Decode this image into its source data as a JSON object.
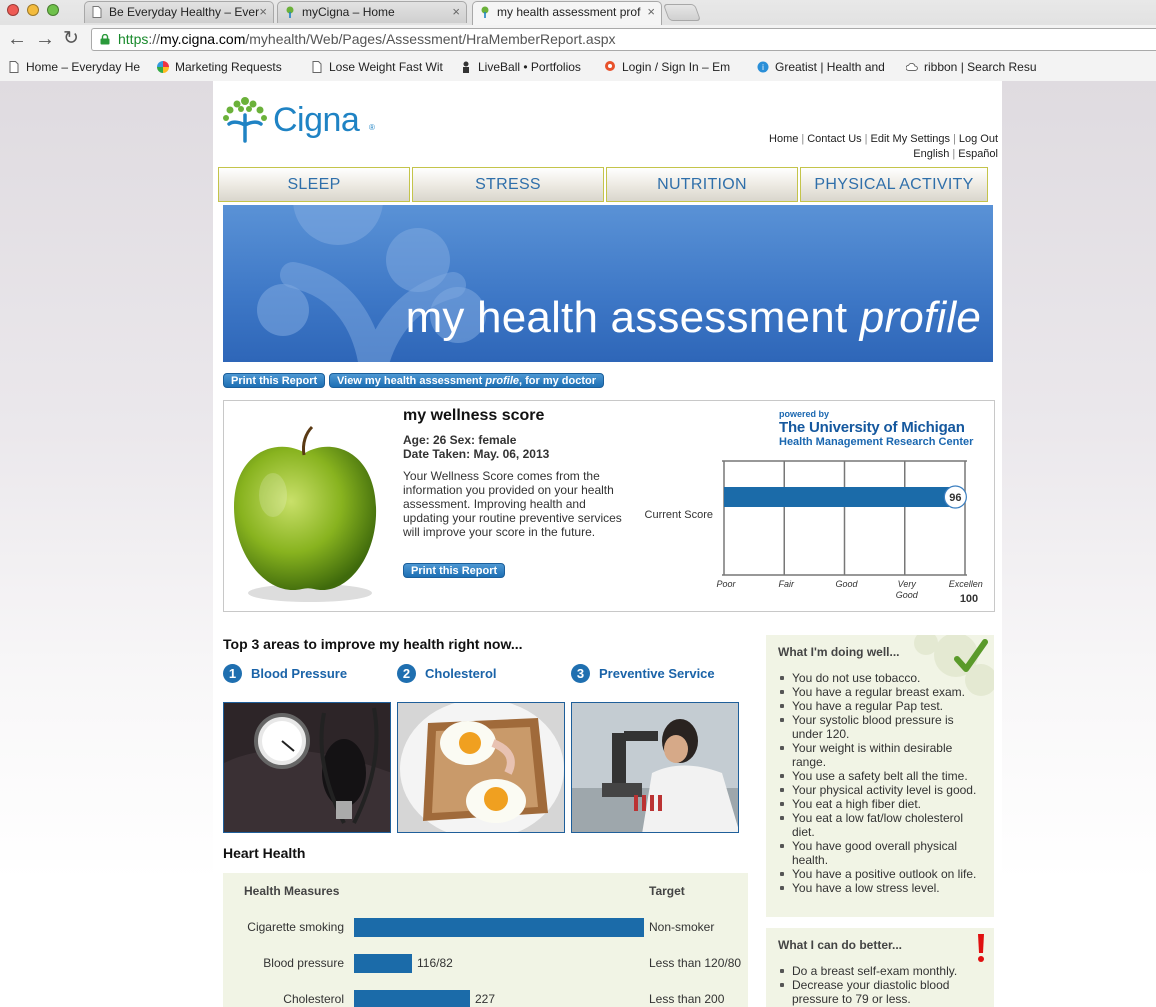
{
  "browser": {
    "tabs": [
      {
        "title": "Be Everyday Healthy – Ever"
      },
      {
        "title": "myCigna – Home"
      },
      {
        "title": "my health assessment prof"
      }
    ],
    "url": {
      "scheme": "https",
      "sep": "://",
      "host": "my.cigna.com",
      "path": "/myhealth/Web/Pages/Assessment/HraMemberReport.aspx"
    },
    "bookmarks": [
      {
        "label": "Home – Everyday He",
        "icon": "page-icon"
      },
      {
        "label": "Marketing Requests",
        "icon": "pinwheel-icon"
      },
      {
        "label": "Lose Weight Fast Wit",
        "icon": "page-icon"
      },
      {
        "label": "LiveBall • Portfolios",
        "icon": "person-icon"
      },
      {
        "label": "Login / Sign In – Em",
        "icon": "pin-icon"
      },
      {
        "label": "Greatist | Health and",
        "icon": "greatist-icon"
      },
      {
        "label": "ribbon | Search Resu",
        "icon": "cloud-icon"
      }
    ],
    "close_glyph": "×"
  },
  "header": {
    "brand": "Cigna",
    "brand_mark": "®",
    "links": [
      "Home",
      "Contact Us",
      "Edit My Settings",
      "Log Out"
    ],
    "languages": [
      "English",
      "Español"
    ],
    "separator": "|"
  },
  "menu": [
    "SLEEP",
    "STRESS",
    "NUTRITION",
    "PHYSICAL ACTIVITY"
  ],
  "banner": {
    "title_main": "my health assessment ",
    "title_em": "profile"
  },
  "actions": {
    "print": "Print this Report",
    "view_prefix": "View my health assessment ",
    "view_em": "profile",
    "view_suffix": ", for my doctor"
  },
  "wellness": {
    "title": "my wellness score",
    "age_sex": "Age: 26 Sex: female",
    "date": "Date Taken: May. 06, 2013",
    "description": "Your Wellness Score comes from the information you provided on your health assessment. Improving health and updating your routine preventive services will improve your score in the future.",
    "print": "Print this Report",
    "powered_by": "powered by",
    "university": "The University of Michigan",
    "center": "Health Management Research Center"
  },
  "chart_data": {
    "type": "bar",
    "orientation": "horizontal",
    "categories": [
      "Current Score"
    ],
    "values": [
      96
    ],
    "data_label": "96",
    "xlim": [
      0,
      100
    ],
    "tick_labels": [
      "Poor",
      "Fair",
      "Good",
      "Very Good",
      "Excellent"
    ],
    "max_label": "100",
    "grid": true,
    "bar_color": "#1b6ba9"
  },
  "improve": {
    "title": "Top 3 areas to improve my health right now...",
    "items": [
      {
        "num": "1",
        "label": "Blood Pressure"
      },
      {
        "num": "2",
        "label": "Cholesterol"
      },
      {
        "num": "3",
        "label": "Preventive Service"
      }
    ]
  },
  "heart": {
    "title": "Heart Health",
    "col_measures": "Health Measures",
    "col_target": "Target",
    "rows": [
      {
        "label": "Cigarette smoking",
        "value": "",
        "target": "Non-smoker",
        "fill": 1.0
      },
      {
        "label": "Blood pressure",
        "value": "116/82",
        "target": "Less than 120/80",
        "fill": 0.2
      },
      {
        "label": "Cholesterol",
        "value": "227",
        "target": "Less than 200",
        "fill": 0.4
      }
    ]
  },
  "doing_well": {
    "title": "What I'm doing well...",
    "items": [
      "You do not use tobacco.",
      "You have a regular breast exam.",
      "You have a regular Pap test.",
      "Your systolic blood pressure is under 120.",
      "Your weight is within desirable range.",
      "You use a safety belt all the time.",
      "Your physical activity level is good.",
      "You eat a high fiber diet.",
      "You eat a low fat/low cholesterol diet.",
      "You have good overall physical health.",
      "You have a positive outlook on life.",
      "You have a low stress level."
    ]
  },
  "do_better": {
    "title": "What I can do better...",
    "items": [
      "Do a breast self-exam monthly.",
      "Decrease your diastolic blood pressure to 79 or less."
    ]
  },
  "colors": {
    "brand_blue": "#1f83c4",
    "bar_blue": "#1b6ba9",
    "panel_green": "#f1f4e5",
    "check_green": "#5a9a2a",
    "alert_red": "#e01010"
  }
}
